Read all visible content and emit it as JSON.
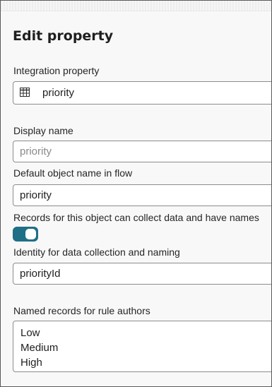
{
  "dialog": {
    "title": "Edit property"
  },
  "integration_property": {
    "label": "Integration property",
    "value": "priority",
    "icon": "table-icon"
  },
  "display_name": {
    "label": "Display name",
    "value": "",
    "placeholder": "priority"
  },
  "default_object_name": {
    "label": "Default object name in flow",
    "value": "priority"
  },
  "collect_data": {
    "label": "Records for this object can collect data and have names",
    "enabled": true,
    "accent_color": "#1f6f86"
  },
  "identity": {
    "label": "Identity for data collection and naming",
    "value": "priorityId"
  },
  "named_records": {
    "label": "Named records for rule authors",
    "lines": [
      "Low",
      "Medium",
      "High"
    ]
  }
}
